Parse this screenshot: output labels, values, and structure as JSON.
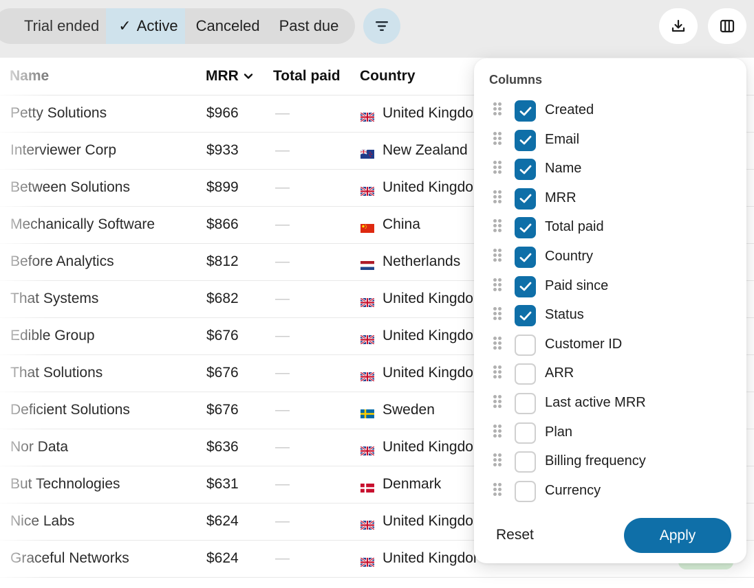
{
  "status_filter": {
    "items": [
      {
        "label": "Trial ended",
        "selected": false
      },
      {
        "label": "Active",
        "selected": true
      },
      {
        "label": "Canceled",
        "selected": false
      },
      {
        "label": "Past due",
        "selected": false
      }
    ],
    "check_glyph": "✓"
  },
  "toolbar": {
    "filter_icon": "filter-lines-icon",
    "download_icon": "download-icon",
    "columns_icon": "columns-icon"
  },
  "table": {
    "headers": {
      "name": "Name",
      "mrr": "MRR",
      "total_paid": "Total paid",
      "country": "Country"
    },
    "sort_icon": "chevron-down-icon",
    "rows": [
      {
        "name": "Petty Solutions",
        "mrr": "$966",
        "total_paid": "—",
        "country": "United Kingdom",
        "flag": "gb"
      },
      {
        "name": "Interviewer Corp",
        "mrr": "$933",
        "total_paid": "—",
        "country": "New Zealand",
        "flag": "nz"
      },
      {
        "name": "Between Solutions",
        "mrr": "$899",
        "total_paid": "—",
        "country": "United Kingdom",
        "flag": "gb"
      },
      {
        "name": "Mechanically Software",
        "mrr": "$866",
        "total_paid": "—",
        "country": "China",
        "flag": "cn"
      },
      {
        "name": "Before Analytics",
        "mrr": "$812",
        "total_paid": "—",
        "country": "Netherlands",
        "flag": "nl"
      },
      {
        "name": "That Systems",
        "mrr": "$682",
        "total_paid": "—",
        "country": "United Kingdom",
        "flag": "gb"
      },
      {
        "name": "Edible Group",
        "mrr": "$676",
        "total_paid": "—",
        "country": "United Kingdom",
        "flag": "gb"
      },
      {
        "name": "That Solutions",
        "mrr": "$676",
        "total_paid": "—",
        "country": "United Kingdom",
        "flag": "gb"
      },
      {
        "name": "Deficient Solutions",
        "mrr": "$676",
        "total_paid": "—",
        "country": "Sweden",
        "flag": "se"
      },
      {
        "name": "Nor Data",
        "mrr": "$636",
        "total_paid": "—",
        "country": "United Kingdom",
        "flag": "gb"
      },
      {
        "name": "But Technologies",
        "mrr": "$631",
        "total_paid": "—",
        "country": "Denmark",
        "flag": "dk"
      },
      {
        "name": "Nice Labs",
        "mrr": "$624",
        "total_paid": "—",
        "country": "United Kingdom",
        "flag": "gb"
      },
      {
        "name": "Graceful Networks",
        "mrr": "$624",
        "total_paid": "—",
        "country": "United Kingdom",
        "flag": "gb"
      }
    ]
  },
  "columns_popover": {
    "title": "Columns",
    "items": [
      {
        "label": "Created",
        "checked": true
      },
      {
        "label": "Email",
        "checked": true
      },
      {
        "label": "Name",
        "checked": true
      },
      {
        "label": "MRR",
        "checked": true
      },
      {
        "label": "Total paid",
        "checked": true
      },
      {
        "label": "Country",
        "checked": true
      },
      {
        "label": "Paid since",
        "checked": true
      },
      {
        "label": "Status",
        "checked": true
      },
      {
        "label": "Customer ID",
        "checked": false
      },
      {
        "label": "ARR",
        "checked": false
      },
      {
        "label": "Last active MRR",
        "checked": false
      },
      {
        "label": "Plan",
        "checked": false
      },
      {
        "label": "Billing frequency",
        "checked": false
      },
      {
        "label": "Currency",
        "checked": false
      }
    ],
    "reset_label": "Reset",
    "apply_label": "Apply"
  },
  "colors": {
    "accent": "#0f6fa8",
    "selected_segment": "#cfe2ec",
    "background": "#ebebeb"
  }
}
